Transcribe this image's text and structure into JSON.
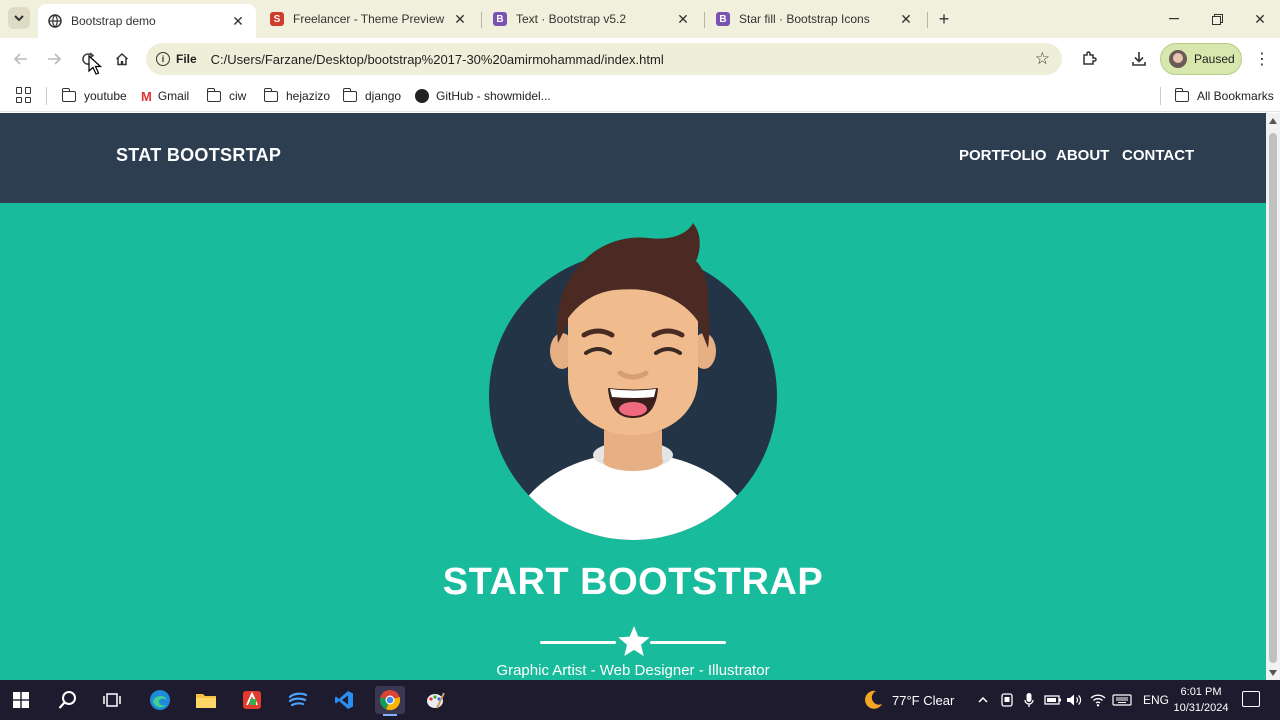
{
  "browser": {
    "tabs": [
      {
        "title": "Bootstrap demo",
        "active": true,
        "favicon": "globe-icon"
      },
      {
        "title": "Freelancer - Theme Preview - St",
        "active": false,
        "favicon": "s-logo-icon",
        "favicon_text": "S",
        "favicon_color": "#d13b2b"
      },
      {
        "title": "Text · Bootstrap v5.2",
        "active": false,
        "favicon": "bootstrap-icon",
        "favicon_text": "B",
        "favicon_color": "#7952b3"
      },
      {
        "title": "Star fill · Bootstrap Icons",
        "active": false,
        "favicon": "bootstrap-icon",
        "favicon_text": "B",
        "favicon_color": "#7952b3"
      }
    ],
    "omnibox": {
      "scheme_label": "File",
      "url": "C:/Users/Farzane/Desktop/bootstrap%2017-30%20amirmohammad/index.html"
    },
    "profile_status": "Paused",
    "bookmarks": [
      {
        "label": "youtube",
        "icon": "folder-icon"
      },
      {
        "label": "Gmail",
        "icon": "gmail-icon",
        "icon_text": "M"
      },
      {
        "label": "ciw",
        "icon": "folder-icon"
      },
      {
        "label": "hejazizo",
        "icon": "folder-icon"
      },
      {
        "label": "django",
        "icon": "folder-icon"
      },
      {
        "label": "GitHub - showmidel...",
        "icon": "github-icon"
      }
    ],
    "all_bookmarks": "All Bookmarks"
  },
  "page": {
    "brand": "STAT BOOTSRTAP",
    "nav": [
      "PORTFOLIO",
      "ABOUT",
      "CONTACT"
    ],
    "hero_title": "START BOOTSTRAP",
    "subtitle": "Graphic Artist - Web Designer - Illustrator",
    "colors": {
      "nav_bg": "#2c3e50",
      "hero_bg": "#18bc9c",
      "text": "#ffffff"
    }
  },
  "taskbar": {
    "weather": "77°F  Clear",
    "language": "ENG",
    "time": "6:01 PM",
    "date": "10/31/2024"
  }
}
